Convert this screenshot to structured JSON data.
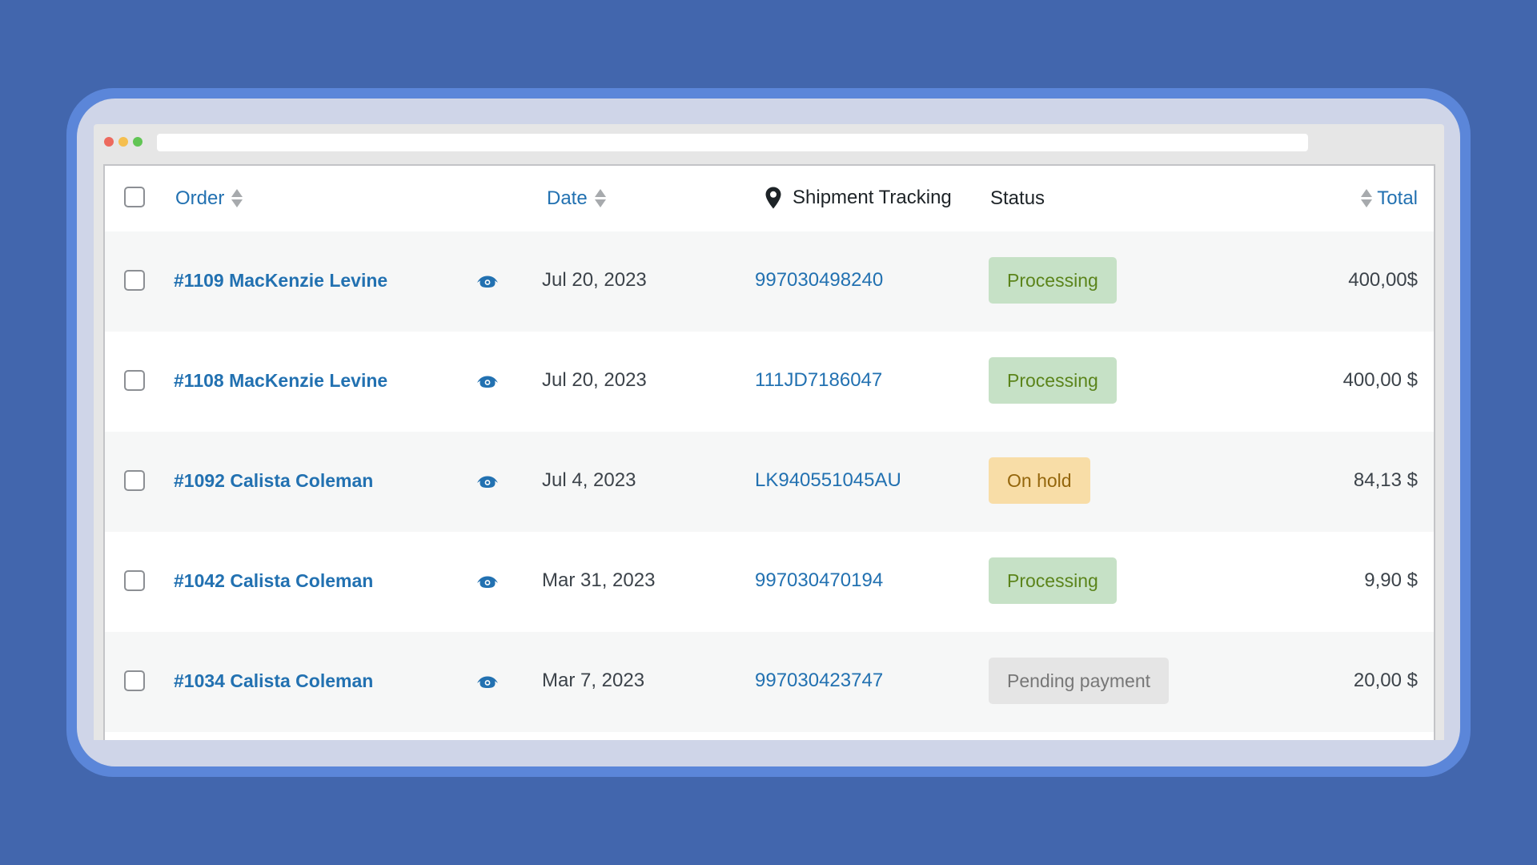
{
  "colors": {
    "background": "#4266ad",
    "link": "#2271b1",
    "processing_bg": "#c6e1c6",
    "processing_text": "#5b841b",
    "on_hold_bg": "#f8dda7",
    "on_hold_text": "#94660c",
    "pending_bg": "#e5e5e5",
    "pending_text": "#777777"
  },
  "window": {
    "controls": [
      "close-dot",
      "minimize-dot",
      "zoom-dot"
    ],
    "address": ""
  },
  "table": {
    "headers": {
      "order": "Order",
      "date": "Date",
      "tracking": "Shipment Tracking",
      "status": "Status",
      "total": "Total"
    },
    "header_icons": {
      "sort": "sort-arrows-icon",
      "tracking": "map-pin-icon"
    },
    "row_icon": "eye-icon",
    "rows": [
      {
        "order": "#1109 MacKenzie Levine",
        "date": "Jul 20, 2023",
        "tracking": "997030498240",
        "status": "Processing",
        "status_type": "processing",
        "total": "400,00$"
      },
      {
        "order": "#1108 MacKenzie Levine",
        "date": "Jul 20, 2023",
        "tracking": "111JD7186047",
        "status": "Processing",
        "status_type": "processing",
        "total": "400,00 $"
      },
      {
        "order": "#1092 Calista Coleman",
        "date": "Jul 4, 2023",
        "tracking": "LK940551045AU",
        "status": "On hold",
        "status_type": "onhold",
        "total": "84,13 $"
      },
      {
        "order": "#1042 Calista Coleman",
        "date": "Mar 31, 2023",
        "tracking": "997030470194",
        "status": "Processing",
        "status_type": "processing",
        "total": "9,90 $"
      },
      {
        "order": "#1034 Calista Coleman",
        "date": "Mar 7, 2023",
        "tracking": "997030423747",
        "status": "Pending payment",
        "status_type": "pending",
        "total": "20,00 $"
      }
    ]
  }
}
